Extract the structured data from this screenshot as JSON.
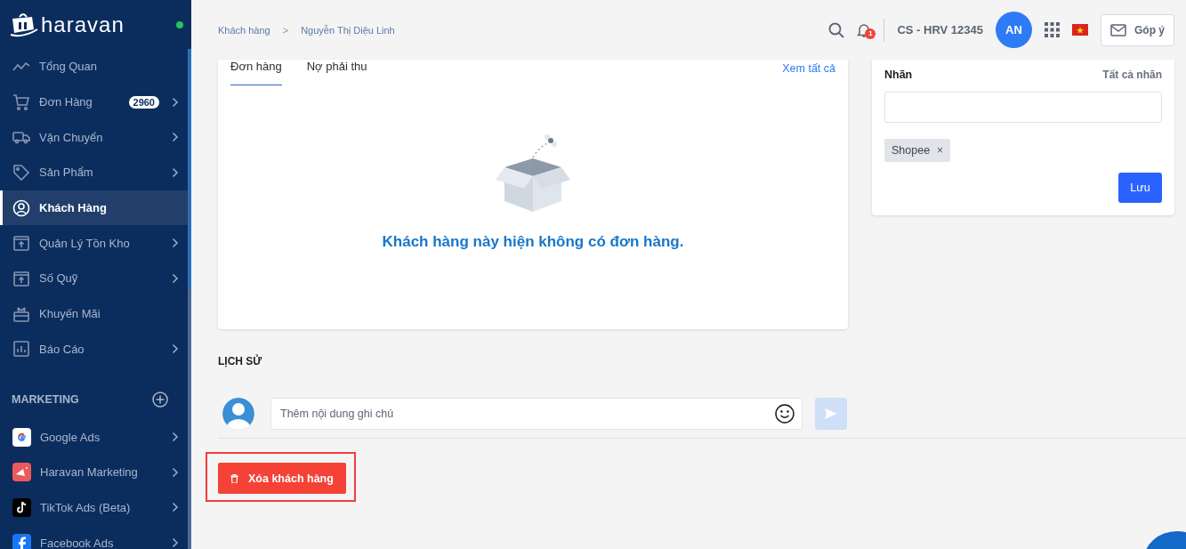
{
  "sidebar": {
    "logo": "haravan",
    "online": true,
    "items": [
      {
        "label": "Tổng Quan",
        "kind": "trend",
        "chevron": false,
        "selected": false
      },
      {
        "label": "Đơn Hàng",
        "kind": "cart",
        "badge": "2960",
        "chevron": true,
        "selected": false
      },
      {
        "label": "Vận Chuyển",
        "kind": "truck",
        "chevron": true,
        "selected": false
      },
      {
        "label": "Sản Phẩm",
        "kind": "tag",
        "chevron": true,
        "selected": false
      },
      {
        "label": "Khách Hàng",
        "kind": "user",
        "chevron": false,
        "selected": true
      },
      {
        "label": "Quản Lý Tồn Kho",
        "kind": "box",
        "chevron": true,
        "selected": false
      },
      {
        "label": "Số Quỹ",
        "kind": "box",
        "chevron": true,
        "selected": false
      },
      {
        "label": "Khuyến Mãi",
        "kind": "gift",
        "chevron": false,
        "selected": false
      },
      {
        "label": "Báo Cáo",
        "kind": "report",
        "chevron": true,
        "selected": false
      }
    ],
    "marketing": {
      "title": "MARKETING",
      "items": [
        {
          "label": "Google Ads",
          "kind": "google"
        },
        {
          "label": "Haravan Marketing",
          "kind": "megaphone"
        },
        {
          "label": "TikTok Ads (Beta)",
          "kind": "tiktok"
        },
        {
          "label": "Facebook Ads",
          "kind": "facebook"
        }
      ]
    }
  },
  "header": {
    "breadcrumb": [
      "Khách hàng",
      "Nguyễn Thị Diệu Linh"
    ],
    "breadcrumb_separator": ">",
    "notifications": "1",
    "store": "CS - HRV 12345",
    "avatar": "AN",
    "feedback": "Góp ý"
  },
  "orders_card": {
    "tabs": [
      {
        "label": "Đơn hàng",
        "selected": true
      },
      {
        "label": "Nợ phải thu",
        "selected": false
      }
    ],
    "view_all": "Xem tất cả",
    "empty_message": "Khách hàng này hiện không có đơn hàng."
  },
  "labels_card": {
    "title": "Nhãn",
    "all_labels": "Tất cả nhãn",
    "tags": [
      {
        "label": "Shopee",
        "remove": "×"
      }
    ],
    "save": "Lưu"
  },
  "history": {
    "title": "LỊCH SỬ",
    "note": {
      "placeholder": "Thêm nội dung ghi chú"
    },
    "send_disabled": true
  },
  "delete_button": {
    "label": "Xóa khách hàng",
    "highlighted": true
  }
}
